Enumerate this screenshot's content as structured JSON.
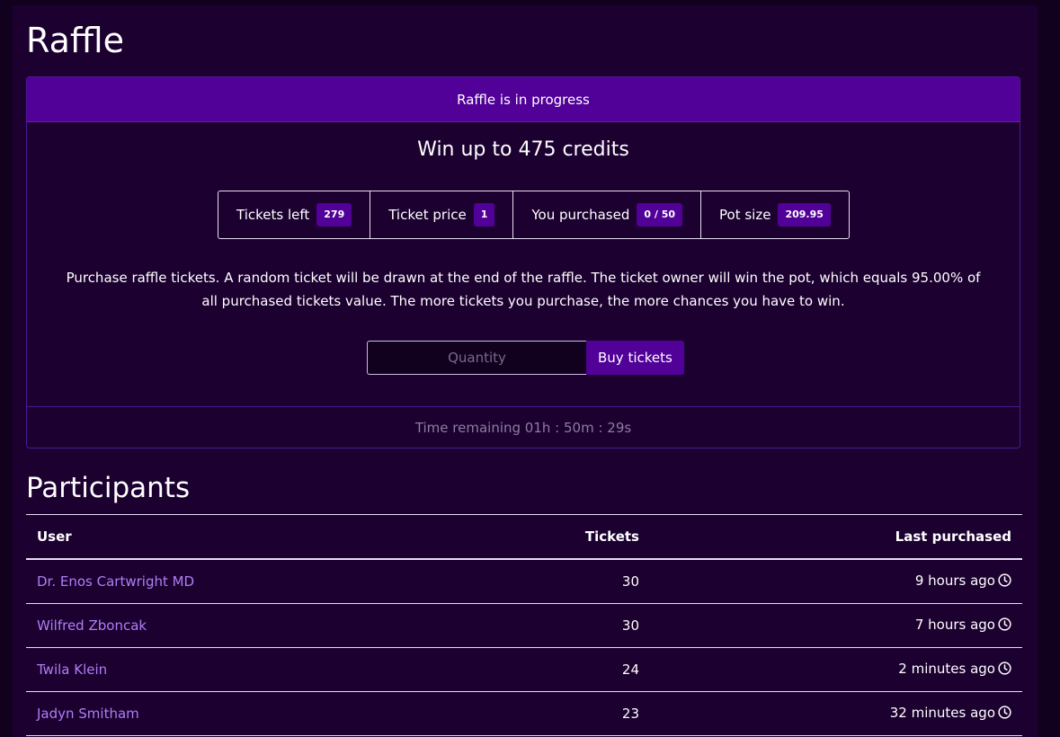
{
  "page": {
    "title": "Raffle"
  },
  "raffle": {
    "status": "Raffle is in progress",
    "headline": "Win up to 475 credits",
    "stats": {
      "tickets_left_label": "Tickets left",
      "tickets_left_value": "279",
      "ticket_price_label": "Ticket price",
      "ticket_price_value": "1",
      "you_purchased_label": "You purchased",
      "you_purchased_value": "0 / 50",
      "pot_size_label": "Pot size",
      "pot_size_value": "209.95"
    },
    "description": "Purchase raffle tickets. A random ticket will be drawn at the end of the raffle. The ticket owner will win the pot, which equals 95.00% of all purchased tickets value. The more tickets you purchase, the more chances you have to win.",
    "form": {
      "quantity_placeholder": "Quantity",
      "quantity_value": "",
      "buy_label": "Buy tickets"
    },
    "time_remaining": "Time remaining 01h : 50m : 29s"
  },
  "participants": {
    "title": "Participants",
    "columns": {
      "user": "User",
      "tickets": "Tickets",
      "last_purchased": "Last purchased"
    },
    "rows": [
      {
        "user": "Dr. Enos Cartwright MD",
        "tickets": "30",
        "last_purchased": "9 hours ago"
      },
      {
        "user": "Wilfred Zboncak",
        "tickets": "30",
        "last_purchased": "7 hours ago"
      },
      {
        "user": "Twila Klein",
        "tickets": "24",
        "last_purchased": "2 minutes ago"
      },
      {
        "user": "Jadyn Smitham",
        "tickets": "23",
        "last_purchased": "32 minutes ago"
      }
    ]
  },
  "icons": {
    "time": "clock-icon"
  },
  "colors": {
    "background": "#1c0030",
    "accent": "#510098",
    "link": "#b07ef5",
    "muted": "#8c7d9f"
  }
}
